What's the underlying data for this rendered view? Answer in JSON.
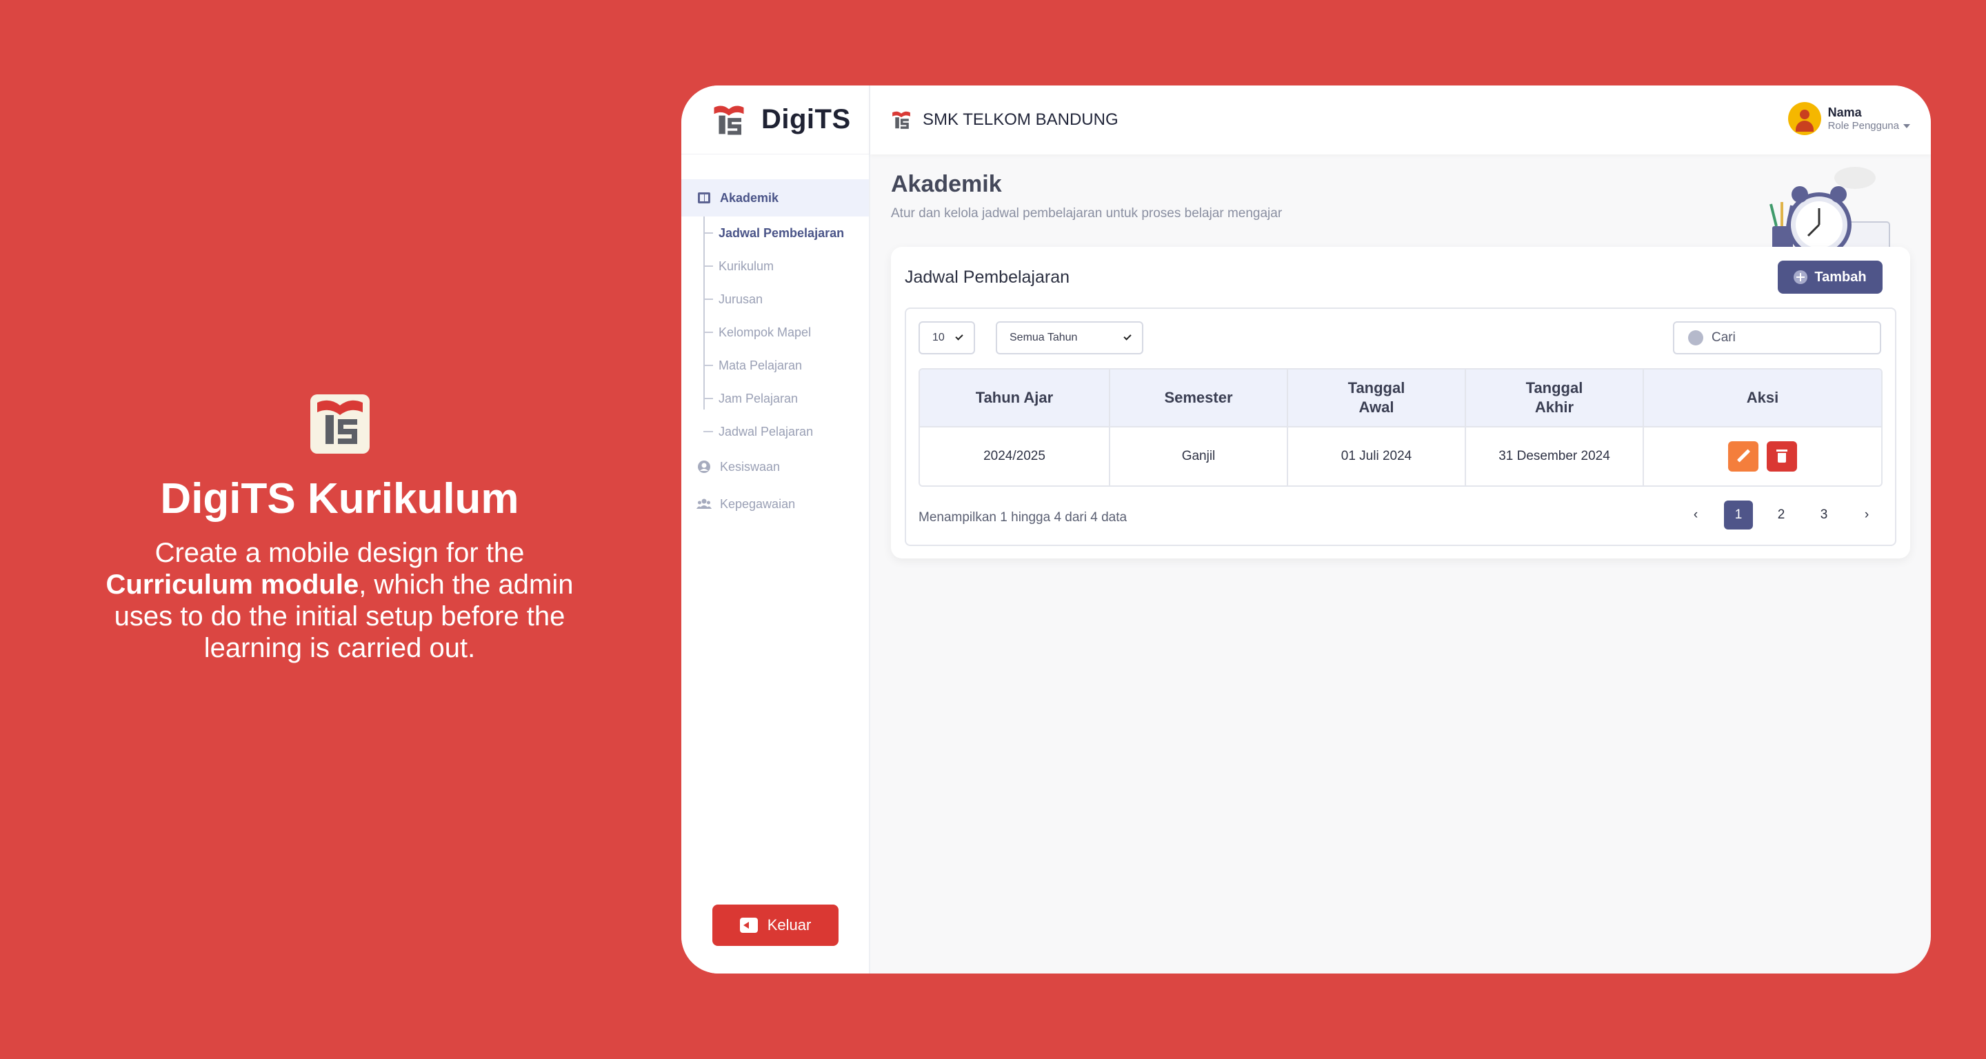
{
  "promo": {
    "title": "DigiTS Kurikulum",
    "desc_1": "Create a mobile design for the ",
    "desc_bold": "Curriculum module",
    "desc_2": ", which the admin uses to do the initial setup before the learning is carried out."
  },
  "brand": {
    "name": "DigiTS",
    "logo_icon": "digits-logo-icon"
  },
  "topbar": {
    "school": "SMK TELKOM BANDUNG"
  },
  "user": {
    "name": "Nama",
    "role": "Role Pengguna"
  },
  "sidebar": {
    "groups": [
      {
        "label": "Akademik",
        "icon": "book-icon",
        "active": true
      },
      {
        "label": "Kesiswaan",
        "icon": "student-icon"
      },
      {
        "label": "Kepegawaian",
        "icon": "staff-icon"
      }
    ],
    "sub_items": [
      "Jadwal Pembelajaran",
      "Kurikulum",
      "Jurusan",
      "Kelompok Mapel",
      "Mata Pelajaran",
      "Jam Pelajaran",
      "Jadwal Pelajaran"
    ],
    "logout_label": "Keluar"
  },
  "page": {
    "title": "Akademik",
    "subtitle": "Atur dan kelola jadwal pembelajaran untuk proses belajar mengajar"
  },
  "card": {
    "title": "Jadwal Pembelajaran",
    "add_label": "Tambah",
    "page_size": "10",
    "year_filter": "Semua Tahun",
    "search_placeholder": "Cari",
    "columns": [
      "Tahun Ajar",
      "Semester",
      "Tanggal\nAwal",
      "Tanggal\nAkhir",
      "Aksi"
    ],
    "rows": [
      {
        "tahun": "2024/2025",
        "semester": "Ganjil",
        "awal": "01 Juli 2024",
        "akhir": "31 Desember 2024"
      }
    ],
    "info": "Menampilkan 1 hingga 4 dari 4 data",
    "pages": [
      "‹",
      "1",
      "2",
      "3",
      "›"
    ],
    "current_page": "1"
  },
  "colors": {
    "background": "#DB4642",
    "accent": "#4F5589",
    "danger": "#DA3833",
    "edit": "#F47E3C"
  }
}
